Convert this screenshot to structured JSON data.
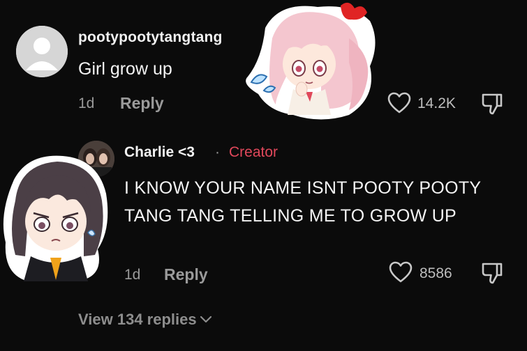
{
  "comment": {
    "username": "pootypootytangtang",
    "text": "Girl grow up",
    "time": "1d",
    "reply_label": "Reply",
    "likes": "14.2K"
  },
  "reply": {
    "username": "Charlie <3",
    "separator": "·",
    "badge": "Creator",
    "text": "I KNOW YOUR NAME ISNT POOTY POOTY TANG TANG TELLING ME TO GROW UP",
    "time": "1d",
    "reply_label": "Reply",
    "likes": "8586"
  },
  "view_replies": {
    "label": "View 134 replies",
    "icon": "chevron-down-icon"
  },
  "colors": {
    "background": "#0b0b0b",
    "creator_badge": "#e0485b",
    "muted": "#9a9a9a"
  },
  "icons": [
    "heart-icon",
    "dislike-icon",
    "default-avatar-icon",
    "chevron-down-icon"
  ]
}
